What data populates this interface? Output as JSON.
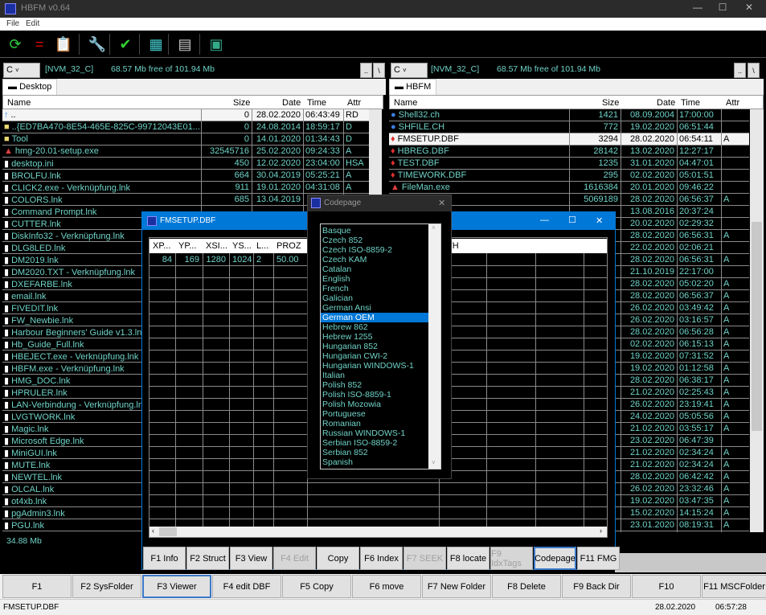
{
  "window": {
    "title": "HBFM v0.64",
    "minimize": "—",
    "maximize": "☐",
    "close": "✕"
  },
  "menu": [
    "File",
    "Edit"
  ],
  "toolbar": [
    {
      "icon": "refresh-icon",
      "glyph": "⟳",
      "color": "#2ecc40"
    },
    {
      "icon": "equal-icon",
      "glyph": "=",
      "color": "#e00000"
    },
    {
      "icon": "clipboard-shortcut-icon",
      "glyph": "📋",
      "color": "#fff"
    },
    {
      "icon": "wrench-icon",
      "glyph": "🔧",
      "color": "#f0a030"
    },
    {
      "icon": "usb-check-icon",
      "glyph": "✔",
      "color": "#3c3"
    },
    {
      "icon": "cubes-icon",
      "glyph": "▦",
      "color": "#4cc"
    },
    {
      "icon": "printer-icon",
      "glyph": "▤",
      "color": "#ccc"
    },
    {
      "icon": "computer-icon",
      "glyph": "▣",
      "color": "#3a8"
    }
  ],
  "colors": {
    "text": "#6fd3c7",
    "accent": "#0078d7",
    "selected": "#0078d7"
  },
  "left": {
    "drive": "C",
    "volume": "[NVM_32_C]",
    "free": "68.57 Mb free of 101.94 Mb",
    "up": "..",
    "root": "\\",
    "tab": "Desktop",
    "columns": [
      "Name",
      "Size",
      "Date",
      "Time",
      "Attr"
    ],
    "footer": "34.88 Mb",
    "rows": [
      {
        "icon": "up",
        "name": "..",
        "size": "0",
        "date": "28.02.2020",
        "time": "06:43:49",
        "attr": "RD",
        "sel": true
      },
      {
        "icon": "folder",
        "name": "..{ED7BA470-8E54-465E-825C-99712043E01...",
        "size": "0",
        "date": "24.08.2014",
        "time": "18:59:17",
        "attr": "D"
      },
      {
        "icon": "folder",
        "name": "Tool",
        "size": "0",
        "date": "14.01.2020",
        "time": "01:34:43",
        "attr": "D"
      },
      {
        "icon": "warn",
        "name": "hmg-20.01-setup.exe",
        "size": "32545716",
        "date": "25.02.2020",
        "time": "09:24:33",
        "attr": "A"
      },
      {
        "icon": "file",
        "name": "desktop.ini",
        "size": "450",
        "date": "12.02.2020",
        "time": "23:04:00",
        "attr": "HSA"
      },
      {
        "icon": "file",
        "name": "BROLFU.lnk",
        "size": "664",
        "date": "30.04.2019",
        "time": "05:25:21",
        "attr": "A"
      },
      {
        "icon": "file",
        "name": "CLICK2.exe - Verknüpfung.lnk",
        "size": "911",
        "date": "19.01.2020",
        "time": "04:31:08",
        "attr": "A"
      },
      {
        "icon": "file",
        "name": "COLORS.lnk",
        "size": "685",
        "date": "13.04.2019"
      },
      {
        "icon": "file",
        "name": "Command Prompt.lnk"
      },
      {
        "icon": "file",
        "name": "CUTTER.lnk"
      },
      {
        "icon": "file",
        "name": "DiskInfo32 - Verknüpfung.lnk"
      },
      {
        "icon": "file",
        "name": "DLG8LED.lnk"
      },
      {
        "icon": "file",
        "name": "DM2019.lnk"
      },
      {
        "icon": "file",
        "name": "DM2020.TXT - Verknüpfung.lnk"
      },
      {
        "icon": "file",
        "name": "DXEFARBE.lnk"
      },
      {
        "icon": "file",
        "name": "email.lnk"
      },
      {
        "icon": "file",
        "name": "FIVEDIT.lnk"
      },
      {
        "icon": "file",
        "name": "FW_Newbie.lnk"
      },
      {
        "icon": "file",
        "name": "Harbour Beginners' Guide v1.3.lnk"
      },
      {
        "icon": "file",
        "name": "Hb_Guide_Full.lnk"
      },
      {
        "icon": "file",
        "name": "HBEJECT.exe - Verknüpfung.lnk"
      },
      {
        "icon": "file",
        "name": "HBFM.exe - Verknüpfung.lnk"
      },
      {
        "icon": "file",
        "name": "HMG_DOC.lnk"
      },
      {
        "icon": "file",
        "name": "HPRULER.lnk"
      },
      {
        "icon": "file",
        "name": "LAN-Verbindung - Verknüpfung.lnk"
      },
      {
        "icon": "file",
        "name": "LVGTWORK.lnk"
      },
      {
        "icon": "file",
        "name": "Magic.lnk"
      },
      {
        "icon": "file",
        "name": "Microsoft Edge.lnk"
      },
      {
        "icon": "file",
        "name": "MiniGUI.lnk"
      },
      {
        "icon": "file",
        "name": "MUTE.lnk"
      },
      {
        "icon": "file",
        "name": "NEWTEL.lnk"
      },
      {
        "icon": "file",
        "name": "OLCAL.lnk"
      },
      {
        "icon": "file",
        "name": "ot4xb.lnk"
      },
      {
        "icon": "file",
        "name": "pgAdmin3.lnk"
      },
      {
        "icon": "file",
        "name": "PGU.lnk"
      }
    ]
  },
  "right": {
    "drive": "C",
    "volume": "[NVM_32_C]",
    "free": "68.57 Mb free of 101.94 Mb",
    "up": "..",
    "root": "\\",
    "tab": "HBFM",
    "columns": [
      "Name",
      "Size",
      "Date",
      "Time",
      "Attr"
    ],
    "rows": [
      {
        "icon": "globe",
        "name": "Shell32.ch",
        "size": "1421",
        "date": "08.09.2004",
        "time": "17:00:00",
        "attr": ""
      },
      {
        "icon": "globe",
        "name": "SHFILE.CH",
        "size": "772",
        "date": "19.02.2020",
        "time": "06:51:44",
        "attr": ""
      },
      {
        "icon": "gem",
        "name": "FMSETUP.DBF",
        "size": "3294",
        "date": "28.02.2020",
        "time": "06:54:11",
        "attr": "A",
        "sel": true
      },
      {
        "icon": "gem",
        "name": "HBREG.DBF",
        "size": "28142",
        "date": "13.02.2020",
        "time": "12:27:17",
        "attr": ""
      },
      {
        "icon": "gem",
        "name": "TEST.DBF",
        "size": "1235",
        "date": "31.01.2020",
        "time": "04:47:01",
        "attr": ""
      },
      {
        "icon": "gem",
        "name": "TIMEWORK.DBF",
        "size": "295",
        "date": "02.02.2020",
        "time": "05:01:51",
        "attr": ""
      },
      {
        "icon": "warn",
        "name": "FileMan.exe",
        "size": "1616384",
        "date": "20.01.2020",
        "time": "09:46:22",
        "attr": ""
      },
      {
        "size": "5069189",
        "date": "28.02.2020",
        "time": "06:56:37",
        "attr": "A"
      },
      {
        "date": "13.08.2016",
        "time": "20:37:24",
        "attr": ""
      },
      {
        "date": "20.02.2020",
        "time": "02:29:32",
        "attr": ""
      },
      {
        "date": "28.02.2020",
        "time": "06:56:31",
        "attr": "A"
      },
      {
        "date": "22.02.2020",
        "time": "02:06:21",
        "attr": ""
      },
      {
        "date": "28.02.2020",
        "time": "06:56:31",
        "attr": "A"
      },
      {
        "date": "21.10.2019",
        "time": "22:17:00",
        "attr": ""
      },
      {
        "date": "28.02.2020",
        "time": "05:02:20",
        "attr": "A"
      },
      {
        "date": "28.02.2020",
        "time": "06:56:37",
        "attr": "A"
      },
      {
        "date": "26.02.2020",
        "time": "03:49:42",
        "attr": "A"
      },
      {
        "date": "26.02.2020",
        "time": "03:16:57",
        "attr": "A"
      },
      {
        "date": "28.02.2020",
        "time": "06:56:28",
        "attr": "A"
      },
      {
        "date": "02.02.2020",
        "time": "06:15:13",
        "attr": "A"
      },
      {
        "date": "19.02.2020",
        "time": "07:31:52",
        "attr": "A"
      },
      {
        "date": "19.02.2020",
        "time": "01:12:58",
        "attr": "A"
      },
      {
        "date": "28.02.2020",
        "time": "06:38:17",
        "attr": "A"
      },
      {
        "date": "21.02.2020",
        "time": "02:25:43",
        "attr": "A"
      },
      {
        "date": "26.02.2020",
        "time": "23:19:41",
        "attr": "A"
      },
      {
        "date": "24.02.2020",
        "time": "05:05:56",
        "attr": "A"
      },
      {
        "date": "21.02.2020",
        "time": "03:55:17",
        "attr": "A"
      },
      {
        "date": "23.02.2020",
        "time": "06:47:39",
        "attr": ""
      },
      {
        "date": "21.02.2020",
        "time": "02:34:24",
        "attr": "A"
      },
      {
        "date": "21.02.2020",
        "time": "02:34:24",
        "attr": "A"
      },
      {
        "date": "28.02.2020",
        "time": "06:42:42",
        "attr": "A"
      },
      {
        "date": "26.02.2020",
        "time": "23:32:46",
        "attr": "A"
      },
      {
        "date": "19.02.2020",
        "time": "03:47:35",
        "attr": "A"
      },
      {
        "date": "15.02.2020",
        "time": "14:15:24",
        "attr": "A"
      },
      {
        "date": "23.01.2020",
        "time": "08:19:31",
        "attr": "A"
      }
    ]
  },
  "dbf_window": {
    "title": "FMSETUP.DBF",
    "minimize": "—",
    "maximize": "☐",
    "close": "✕",
    "columns": [
      "XP...",
      "YP...",
      "XSI...",
      "YS...",
      "L...",
      "PROZ"
    ],
    "hidden_column_tail": "TH",
    "row": [
      "84",
      "169",
      "1280",
      "1024",
      "2",
      "50.00"
    ],
    "buttons": [
      {
        "label": "F1 Info"
      },
      {
        "label": "F2 Struct"
      },
      {
        "label": "F3 View"
      },
      {
        "label": "F4 Edit",
        "disabled": true
      },
      {
        "label": "Copy"
      },
      {
        "label": "F6 Index"
      },
      {
        "label": "F7 SEEK",
        "disabled": true
      },
      {
        "label": "F8 locate"
      },
      {
        "label": "F9 IdxTags",
        "disabled": true
      },
      {
        "label": "Codepage",
        "focused": true
      },
      {
        "label": "F11 FMG"
      }
    ]
  },
  "codepage_dialog": {
    "title": "Codepage",
    "close": "✕",
    "selected": "German OEM",
    "items": [
      "Basque",
      "Czech 852",
      "Czech ISO-8859-2",
      "Czech KAM",
      "Catalan",
      "English",
      "French",
      "Galician",
      "German Ansi",
      "German OEM",
      "Hebrew 862",
      "Hebrew 1255",
      "Hungarian 852",
      "Hungarian CWI-2",
      "Hungarian WINDOWS-1",
      "Italian",
      "Polish 852",
      "Polish ISO-8859-1",
      "Polish Mozowia",
      "Portuguese",
      "Romanian",
      "Russian WINDOWS-1",
      "Serbian ISO-8859-2",
      "Serbian 852",
      "Spanish"
    ]
  },
  "fkeys": [
    {
      "label": "F1"
    },
    {
      "label": "F2 SysFolder"
    },
    {
      "label": "F3 Viewer",
      "focused": true
    },
    {
      "label": "F4 edit DBF"
    },
    {
      "label": "F5 Copy"
    },
    {
      "label": "F6 move"
    },
    {
      "label": "F7 New Folder"
    },
    {
      "label": "F8 Delete"
    },
    {
      "label": "F9 Back Dir"
    },
    {
      "label": "F10"
    },
    {
      "label": "F11 MSCFolder"
    }
  ],
  "status": {
    "file": "FMSETUP.DBF",
    "date": "28.02.2020",
    "time": "06:57:28"
  }
}
